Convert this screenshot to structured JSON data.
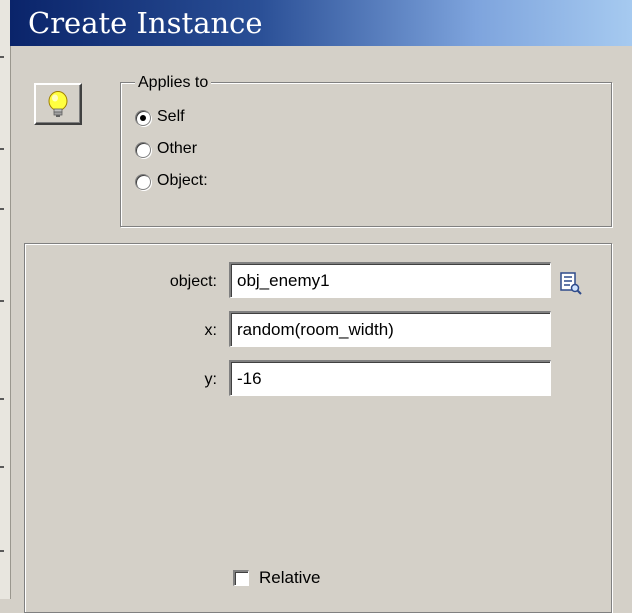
{
  "window": {
    "title": "Create Instance"
  },
  "applies_to": {
    "legend": "Applies to",
    "options": [
      {
        "label": "Self",
        "selected": true
      },
      {
        "label": "Other",
        "selected": false
      },
      {
        "label": "Object:",
        "selected": false
      }
    ]
  },
  "fields": {
    "object": {
      "label": "object:",
      "value": "obj_enemy1"
    },
    "x": {
      "label": "x:",
      "value": "random(room_width)"
    },
    "y": {
      "label": "y:",
      "value": "-16"
    }
  },
  "relative": {
    "label": "Relative",
    "checked": false
  },
  "icons": {
    "action": "lightbulb-icon",
    "browse": "object-browse-icon"
  },
  "colors": {
    "title_bar_start": "#0a246a",
    "title_bar_end": "#a6caf0",
    "dialog_face": "#d4d0c8"
  }
}
